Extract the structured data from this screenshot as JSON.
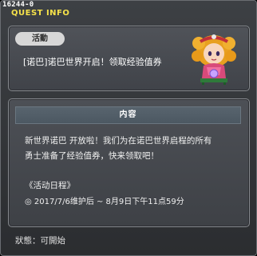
{
  "window": {
    "quest_id": "16244-0",
    "title": "QUEST INFO"
  },
  "quest": {
    "tag": "活動",
    "name": "[诺巴]诺巴世界开启！领取经验值券",
    "npc_icon": "npc-portrait"
  },
  "content": {
    "header": "内容",
    "lines": [
      "新世界诺巴 开放啦！我们为在诺巴世界启程的所有",
      "勇士准备了经验值券，快来领取吧！"
    ],
    "schedule_title": "《活动日程》",
    "schedule_time": "◎ 2017/7/6维护后 ~ 8月9日下午11点59分"
  },
  "status": {
    "label": "狀態：",
    "value": "可開始"
  },
  "colors": {
    "title": "#f6e24a",
    "panel_bg": "#45484d",
    "tag_bg": "#d7d7d7"
  }
}
